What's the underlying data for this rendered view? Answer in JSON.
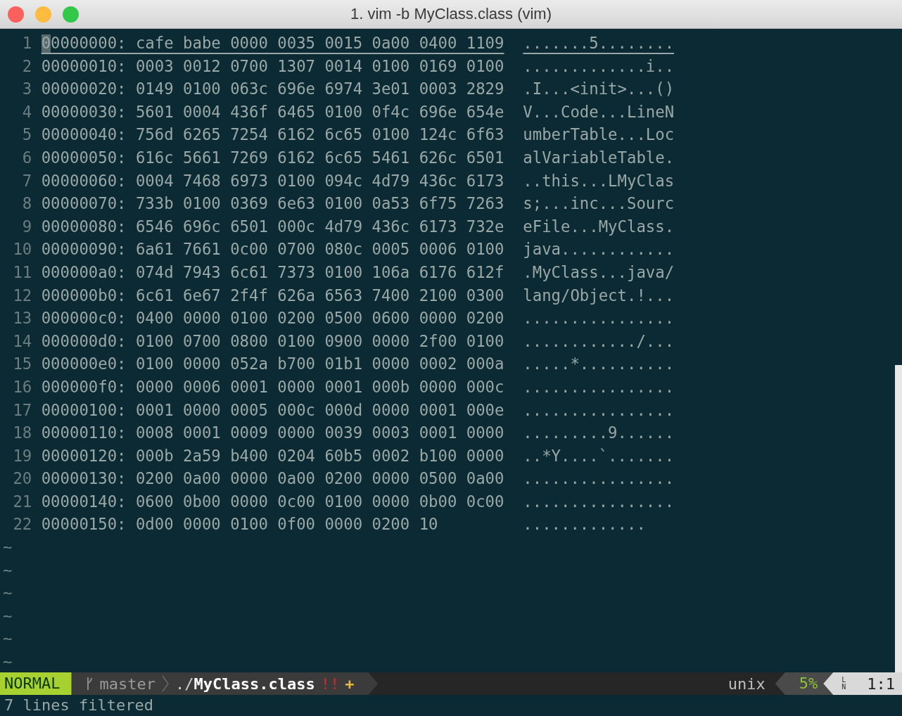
{
  "window": {
    "title": "1. vim -b MyClass.class (vim)"
  },
  "lines": [
    {
      "number": "1",
      "hex": "00000000: cafe babe 0000 0035 0015 0a00 0400 1109",
      "ascii": ".......5........",
      "selected": true
    },
    {
      "number": "2",
      "hex": "00000010: 0003 0012 0700 1307 0014 0100 0169 0100",
      "ascii": ".............i..",
      "selected": false
    },
    {
      "number": "3",
      "hex": "00000020: 0149 0100 063c 696e 6974 3e01 0003 2829",
      "ascii": ".I...<init>...()",
      "selected": false
    },
    {
      "number": "4",
      "hex": "00000030: 5601 0004 436f 6465 0100 0f4c 696e 654e",
      "ascii": "V...Code...LineN",
      "selected": false
    },
    {
      "number": "5",
      "hex": "00000040: 756d 6265 7254 6162 6c65 0100 124c 6f63",
      "ascii": "umberTable...Loc",
      "selected": false
    },
    {
      "number": "6",
      "hex": "00000050: 616c 5661 7269 6162 6c65 5461 626c 6501",
      "ascii": "alVariableTable.",
      "selected": false
    },
    {
      "number": "7",
      "hex": "00000060: 0004 7468 6973 0100 094c 4d79 436c 6173",
      "ascii": "..this...LMyClas",
      "selected": false
    },
    {
      "number": "8",
      "hex": "00000070: 733b 0100 0369 6e63 0100 0a53 6f75 7263",
      "ascii": "s;...inc...Sourc",
      "selected": false
    },
    {
      "number": "9",
      "hex": "00000080: 6546 696c 6501 000c 4d79 436c 6173 732e",
      "ascii": "eFile...MyClass.",
      "selected": false
    },
    {
      "number": "10",
      "hex": "00000090: 6a61 7661 0c00 0700 080c 0005 0006 0100",
      "ascii": "java............",
      "selected": false
    },
    {
      "number": "11",
      "hex": "000000a0: 074d 7943 6c61 7373 0100 106a 6176 612f",
      "ascii": ".MyClass...java/",
      "selected": false
    },
    {
      "number": "12",
      "hex": "000000b0: 6c61 6e67 2f4f 626a 6563 7400 2100 0300",
      "ascii": "lang/Object.!...",
      "selected": false
    },
    {
      "number": "13",
      "hex": "000000c0: 0400 0000 0100 0200 0500 0600 0000 0200",
      "ascii": "................",
      "selected": false
    },
    {
      "number": "14",
      "hex": "000000d0: 0100 0700 0800 0100 0900 0000 2f00 0100",
      "ascii": "............/...",
      "selected": false
    },
    {
      "number": "15",
      "hex": "000000e0: 0100 0000 052a b700 01b1 0000 0002 000a",
      "ascii": ".....*..........",
      "selected": false
    },
    {
      "number": "16",
      "hex": "000000f0: 0000 0006 0001 0000 0001 000b 0000 000c",
      "ascii": "................",
      "selected": false
    },
    {
      "number": "17",
      "hex": "00000100: 0001 0000 0005 000c 000d 0000 0001 000e",
      "ascii": "................",
      "selected": false
    },
    {
      "number": "18",
      "hex": "00000110: 0008 0001 0009 0000 0039 0003 0001 0000",
      "ascii": ".........9......",
      "selected": false
    },
    {
      "number": "19",
      "hex": "00000120: 000b 2a59 b400 0204 60b5 0002 b100 0000",
      "ascii": "..*Y....`.......",
      "selected": false
    },
    {
      "number": "20",
      "hex": "00000130: 0200 0a00 0000 0a00 0200 0000 0500 0a00",
      "ascii": "................",
      "selected": false
    },
    {
      "number": "21",
      "hex": "00000140: 0600 0b00 0000 0c00 0100 0000 0b00 0c00",
      "ascii": "................",
      "selected": false
    },
    {
      "number": "22",
      "hex": "00000150: 0d00 0000 0100 0f00 0000 0200 10",
      "ascii": ".............",
      "selected": false
    }
  ],
  "empty_lines": [
    "~",
    "~",
    "~",
    "~",
    "~",
    "~"
  ],
  "status_bar": {
    "mode": "NORMAL",
    "branch": "master",
    "file": "./**MyClass.class**",
    "readonly_flag": "!!",
    "modified_flag": "+",
    "fileformat": "unix",
    "percent": "5%",
    "line_symbol": "LN",
    "position": "1:1"
  },
  "message": "7 lines filtered"
}
